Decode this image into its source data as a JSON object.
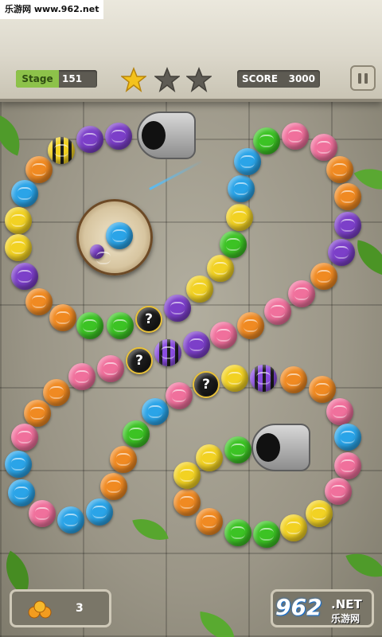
{
  "watermark": "乐游网 www.962.net",
  "hud": {
    "stage_label": "Stage",
    "stage_value": "151",
    "stars_earned": 1,
    "stars_total": 3,
    "score_label": "SCORE",
    "score_value": "3000",
    "pause_icon": "pause-icon"
  },
  "ball_colors": {
    "purple": "#7c3fc9",
    "orange": "#f08a22",
    "blue": "#2aa4e8",
    "yellow": "#f2d223",
    "green": "#3cc324",
    "pink": "#f0709c"
  },
  "mystery_label": "?",
  "shooter": {
    "current_ball": "blue",
    "next_ball": "purple"
  },
  "bottom": {
    "coin_icon": "coin-pile-icon",
    "coin_count": "3"
  },
  "logo": {
    "number": "962",
    "suffix": ".NET",
    "chinese": "乐游网"
  }
}
